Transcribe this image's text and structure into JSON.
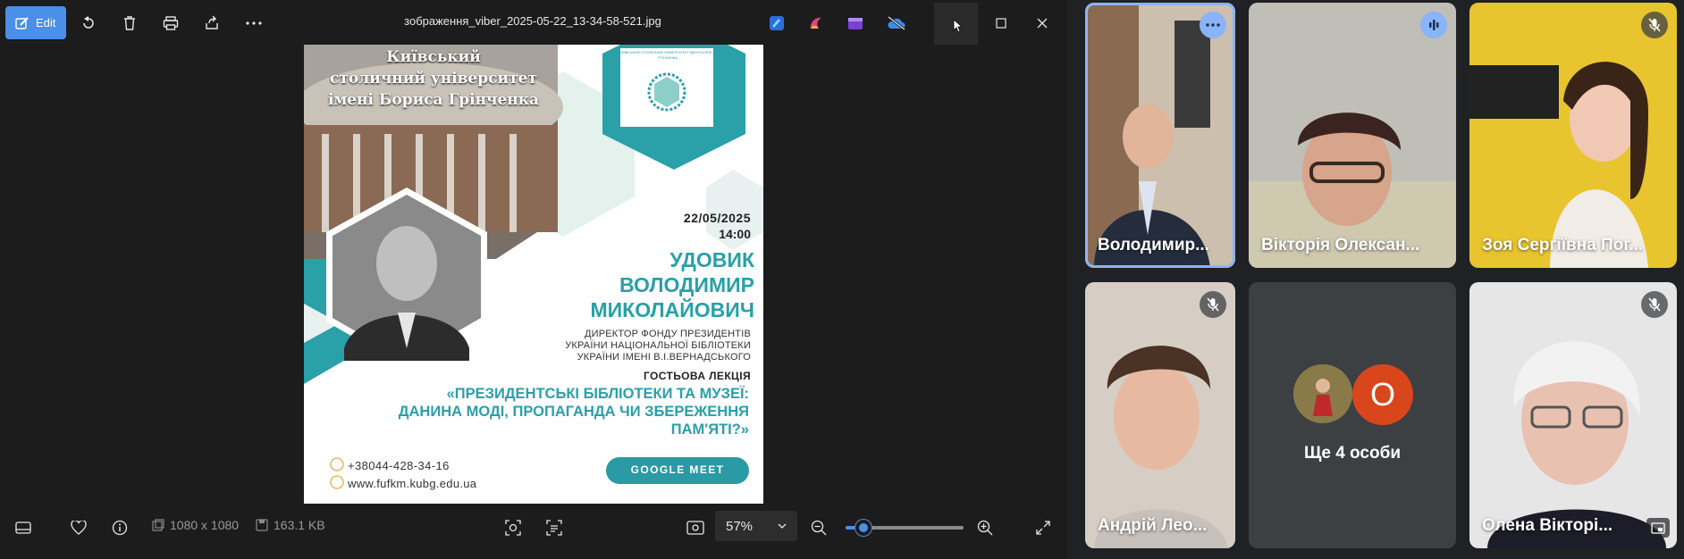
{
  "viewer": {
    "edit_label": "Edit",
    "file_name": "зображення_viber_2025-05-22_13-34-58-521.jpg",
    "dimensions": "1080 x 1080",
    "file_size": "163.1 KB",
    "zoom": "57%",
    "zoom_fraction": 0.15
  },
  "poster": {
    "uni_line1": "Київський",
    "uni_line2": "столичний університет",
    "uni_line3": "імені Бориса Грінченка",
    "logo_text": "КИЇВСЬКИЙ СТОЛИЧНИЙ УНІВЕРСИТЕТ ІМЕНІ БОРИСА ГРІНЧЕНКА",
    "date": "22/05/2025",
    "time": "14:00",
    "name_1": "УДОВИК",
    "name_2": "ВОЛОДИМИР",
    "name_3": "МИКОЛАЙОВИЧ",
    "role_1": "ДИРЕКТОР ФОНДУ ПРЕЗИДЕНТІВ",
    "role_2": "УКРАЇНИ НАЦІОНАЛЬНОЇ БІБЛІОТЕКИ",
    "role_3": "УКРАЇНИ ІМЕНІ В.І.ВЕРНАДСЬКОГО",
    "lecture_type": "ГОСТЬОВА ЛЕКЦІЯ",
    "topic_1": "«ПРЕЗИДЕНТСЬКІ БІБЛІОТЕКИ ТА МУЗЕЇ:",
    "topic_2": "ДАНИНА МОДІ, ПРОПАГАНДА ЧИ ЗБЕРЕЖЕННЯ",
    "topic_3": "ПАМ'ЯТІ?»",
    "phone": "+38044-428-34-16",
    "website": "www.fufkm.kubg.edu.ua",
    "meet_button": "GOOGLE MEET"
  },
  "meet": {
    "participants": [
      {
        "name": "Володимир...",
        "state": "active-more"
      },
      {
        "name": "Вікторія Олексан...",
        "state": "speaking"
      },
      {
        "name": "Зоя Сергіївна Пог...",
        "state": "muted"
      },
      {
        "name": "Андрій Лео...",
        "state": "muted"
      },
      {
        "name": "Олена Вікторі...",
        "state": "muted"
      }
    ],
    "others_label": "Ще 4 особи",
    "others_avatar_letter": "О"
  },
  "colors": {
    "accent": "#4a8fe8",
    "teal": "#2aa0a8",
    "meet_blue": "#8ab4f8",
    "avatar_orange": "#d9461c"
  }
}
